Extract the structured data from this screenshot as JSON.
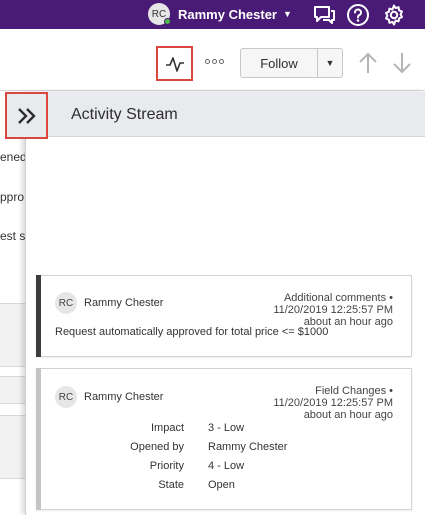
{
  "colors": {
    "topbar": "#4a1a77",
    "highlight_border": "#d9473f",
    "comment_bar": "#3d3d3d",
    "changes_bar": "#c4c4c4",
    "presence": "#51b84a"
  },
  "header": {
    "user_initials": "RC",
    "user_name": "Rammy Chester",
    "icons": [
      "chevron-down-icon",
      "chat-icon",
      "help-icon",
      "gear-icon"
    ]
  },
  "toolbar": {
    "activity_icon": "activity-pulse-icon",
    "more_icon": "more-options-icon",
    "follow_label": "Follow",
    "nav_icons": [
      "arrow-up-icon",
      "arrow-down-icon"
    ]
  },
  "left_fragments": [
    "ened",
    "ppro",
    "est st"
  ],
  "panel": {
    "title": "Activity Stream",
    "collapse_icon": "double-chevron-right-icon"
  },
  "activities": [
    {
      "initials": "RC",
      "user": "Rammy Chester",
      "type": "Additional comments",
      "timestamp": "11/20/2019 12:25:57 PM",
      "relative": "about an hour ago",
      "message": "Request automatically approved for total price <= $1000"
    },
    {
      "initials": "RC",
      "user": "Rammy Chester",
      "type": "Field Changes",
      "timestamp": "11/20/2019 12:25:57 PM",
      "relative": "about an hour ago",
      "fields": [
        {
          "label": "Impact",
          "value": "3 - Low"
        },
        {
          "label": "Opened by",
          "value": "Rammy Chester"
        },
        {
          "label": "Priority",
          "value": "4 - Low"
        },
        {
          "label": "State",
          "value": "Open"
        }
      ]
    }
  ],
  "bullet": "•"
}
